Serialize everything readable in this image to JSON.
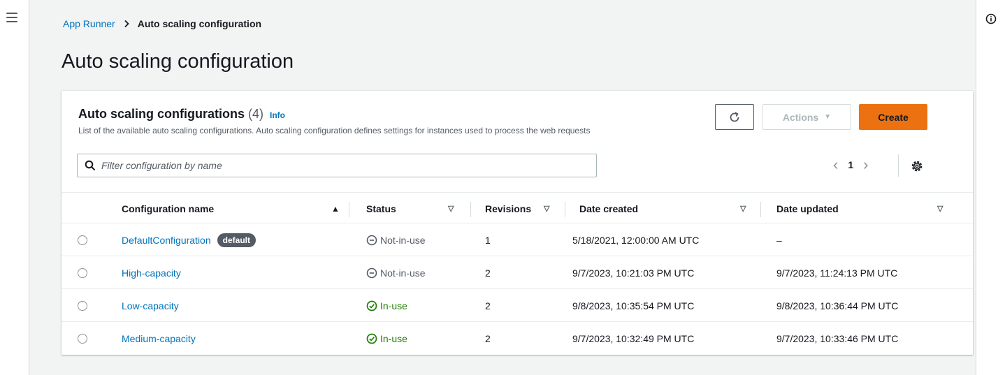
{
  "breadcrumb": {
    "parent": "App Runner",
    "current": "Auto scaling configuration"
  },
  "page": {
    "title": "Auto scaling configuration"
  },
  "panel": {
    "title": "Auto scaling configurations",
    "count": "(4)",
    "info_label": "Info",
    "description": "List of the available auto scaling configurations. Auto scaling configuration defines settings for instances used to process the web requests",
    "actions_label": "Actions",
    "create_label": "Create",
    "filter_placeholder": "Filter configuration by name",
    "page_number": "1"
  },
  "table": {
    "columns": {
      "name": "Configuration name",
      "status": "Status",
      "revisions": "Revisions",
      "created": "Date created",
      "updated": "Date updated"
    },
    "rows": [
      {
        "name": "DefaultConfiguration",
        "badge": "default",
        "status": "Not-in-use",
        "status_kind": "notinuse",
        "revisions": "1",
        "created": "5/18/2021, 12:00:00 AM UTC",
        "updated": "–"
      },
      {
        "name": "High-capacity",
        "badge": "",
        "status": "Not-in-use",
        "status_kind": "notinuse",
        "revisions": "2",
        "created": "9/7/2023, 10:21:03 PM UTC",
        "updated": "9/7/2023, 11:24:13 PM UTC"
      },
      {
        "name": "Low-capacity",
        "badge": "",
        "status": "In-use",
        "status_kind": "inuse",
        "revisions": "2",
        "created": "9/8/2023, 10:35:54 PM UTC",
        "updated": "9/8/2023, 10:36:44 PM UTC"
      },
      {
        "name": "Medium-capacity",
        "badge": "",
        "status": "In-use",
        "status_kind": "inuse",
        "revisions": "2",
        "created": "9/7/2023, 10:32:49 PM UTC",
        "updated": "9/7/2023, 10:33:46 PM UTC"
      }
    ]
  },
  "colors": {
    "link": "#0073bb",
    "accent": "#ec7211",
    "success": "#1d8102",
    "muted": "#545b64"
  },
  "icons": {
    "menu": "hamburger-icon",
    "info": "info-circle-icon",
    "refresh": "refresh-icon",
    "search": "search-icon",
    "settings": "gear-icon"
  }
}
